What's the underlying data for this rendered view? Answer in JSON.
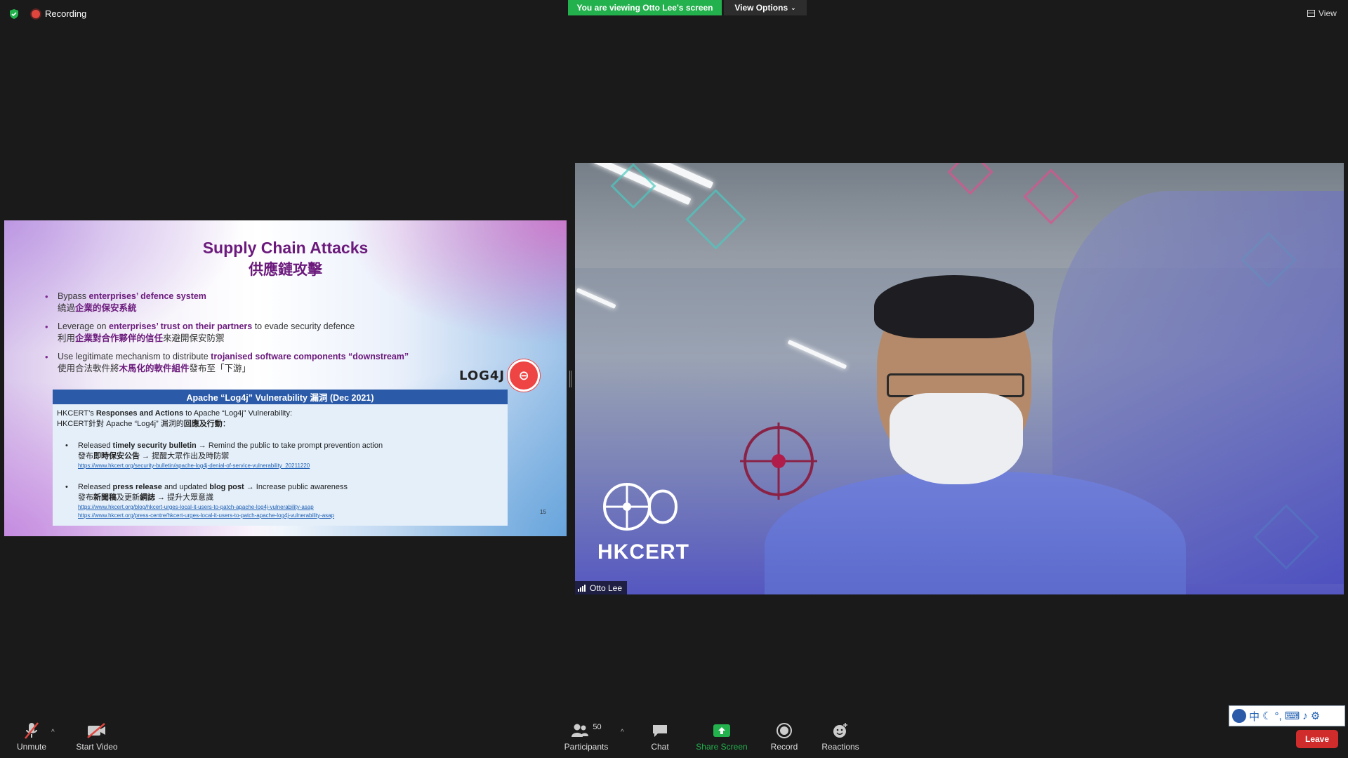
{
  "top_bar": {
    "recording_label": "Recording",
    "viewing_banner": "You are viewing Otto Lee's screen",
    "view_options_label": "View Options",
    "view_label": "View"
  },
  "slide": {
    "title_en": "Supply Chain Attacks",
    "title_zh": "供應鏈攻擊",
    "bullets": [
      {
        "en_pre": "Bypass ",
        "en_bold": "enterprises’ defence system",
        "en_post": "",
        "zh_pre": "繞過",
        "zh_bold": "企業的保安系統",
        "zh_post": ""
      },
      {
        "en_pre": "Leverage on ",
        "en_bold": "enterprises’ trust on their partners",
        "en_post": " to evade security defence",
        "zh_pre": "利用",
        "zh_bold": "企業對合作夥伴的信任",
        "zh_post": "來避開保安防禦"
      },
      {
        "en_pre": "Use legitimate mechanism to distribute ",
        "en_bold": "trojanised software components “downstream”",
        "en_post": "",
        "zh_pre": "使用合法軟件將",
        "zh_bold": "木馬化的軟件組件",
        "zh_post": "發布至「下游」"
      }
    ],
    "logo_text": "LOG4J",
    "box_title": "Apache “Log4j” Vulnerability 漏洞 (Dec 2021)",
    "box_intro_en_pre": "HKCERT’s ",
    "box_intro_en_bold": "Responses and Actions",
    "box_intro_en_post": " to Apache “Log4j” Vulnerability:",
    "box_intro_zh_pre": "HKCERT針對 Apache “Log4j” 漏洞的",
    "box_intro_zh_bold": "回應及行動",
    "box_intro_zh_post": "：",
    "item1_en_pre": "Released ",
    "item1_en_bold": "timely security bulletin",
    "item1_en_post": " → Remind the public to take prompt prevention action",
    "item1_zh_pre": "發布",
    "item1_zh_bold": "即時保安公告",
    "item1_zh_post": " → 提醒大眾作出及時防禦",
    "item1_link": "https://www.hkcert.org/security-bulletin/apache-log4j-denial-of-service-vulnerability_20211220",
    "item2_en_pre": "Released ",
    "item2_en_bold1": "press release",
    "item2_en_mid": " and updated ",
    "item2_en_bold2": "blog post",
    "item2_en_post": " → Increase public awareness",
    "item2_zh_pre": "發布",
    "item2_zh_bold1": "新聞稿",
    "item2_zh_mid": "及更新",
    "item2_zh_bold2": "網誌",
    "item2_zh_post": " → 提升大眾意識",
    "item2_link1": "https://www.hkcert.org/blog/hkcert-urges-local-it-users-to-patch-apache-log4j-vulnerability-asap",
    "item2_link2": "https://www.hkcert.org/press-centre/hkcert-urges-local-it-users-to-patch-apache-log4j-vulnerability-asap",
    "page_number": "15"
  },
  "video": {
    "participant_name": "Otto Lee",
    "wall_logo_text": "HKCERT"
  },
  "toolbar": {
    "unmute": "Unmute",
    "start_video": "Start Video",
    "participants": "Participants",
    "participants_count": "50",
    "chat": "Chat",
    "share_screen": "Share Screen",
    "record": "Record",
    "reactions": "Reactions",
    "leave": "Leave"
  },
  "ime_bar": {
    "lang": "中"
  },
  "colors": {
    "green_banner": "#23b14d",
    "leave_red": "#d02c2c",
    "share_green": "#23b14d",
    "slide_title_purple": "#6b1a7c",
    "box_header_blue": "#2b5aa8"
  },
  "icons": [
    "shield-icon",
    "recording-icon",
    "chevron-down-icon",
    "grid-view-icon",
    "mic-muted-icon",
    "video-off-icon",
    "participants-icon",
    "chat-icon",
    "share-screen-icon",
    "record-icon",
    "reactions-icon",
    "signal-icon"
  ]
}
